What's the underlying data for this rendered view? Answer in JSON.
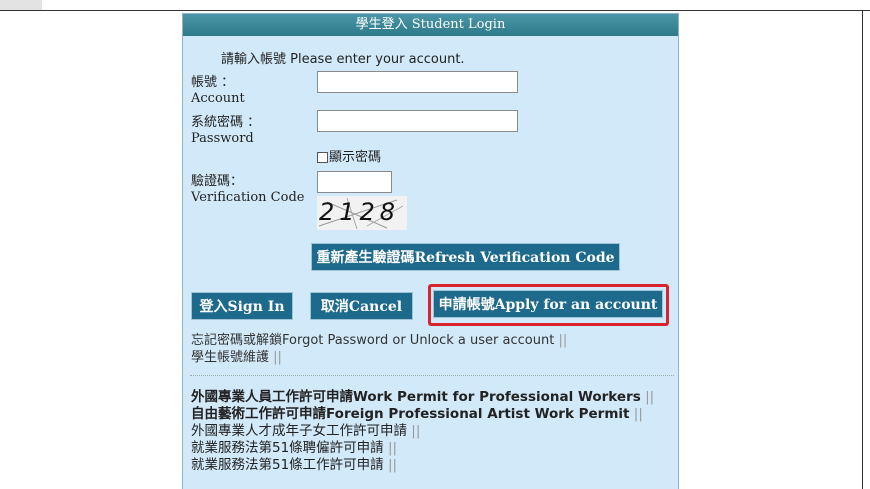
{
  "header": {
    "title": "學生登入 Student Login"
  },
  "intro": "請輸入帳號 Please enter your account.",
  "account": {
    "label_zh": "帳號 ：",
    "label_en": "Account",
    "value": ""
  },
  "password": {
    "label_zh": "系統密碼 ：",
    "label_en": "Password",
    "value": ""
  },
  "show_password": {
    "label": "顯示密碼",
    "checked": false
  },
  "verification": {
    "label_zh": "驗證碼：",
    "label_en": "Verification Code",
    "value": "",
    "captcha": "2128"
  },
  "buttons": {
    "refresh": "重新產生驗證碼Refresh Verification Code",
    "sign_in": "登入Sign In",
    "cancel": "取消Cancel",
    "apply": "申請帳號Apply for an account"
  },
  "links": {
    "forgot": "忘記密碼或解鎖Forgot Password or Unlock a user account",
    "maintain": "學生帳號維護",
    "work_permit": "外國專業人員工作許可申請Work Permit for Professional Workers",
    "artist_permit": "自由藝術工作許可申請Foreign Professional Artist Work Permit",
    "adult_children": "外國專業人才成年子女工作許可申請",
    "art51_hire": "就業服務法第51條聘僱許可申請",
    "art51_work": "就業服務法第51條工作許可申請",
    "separator": "||"
  }
}
